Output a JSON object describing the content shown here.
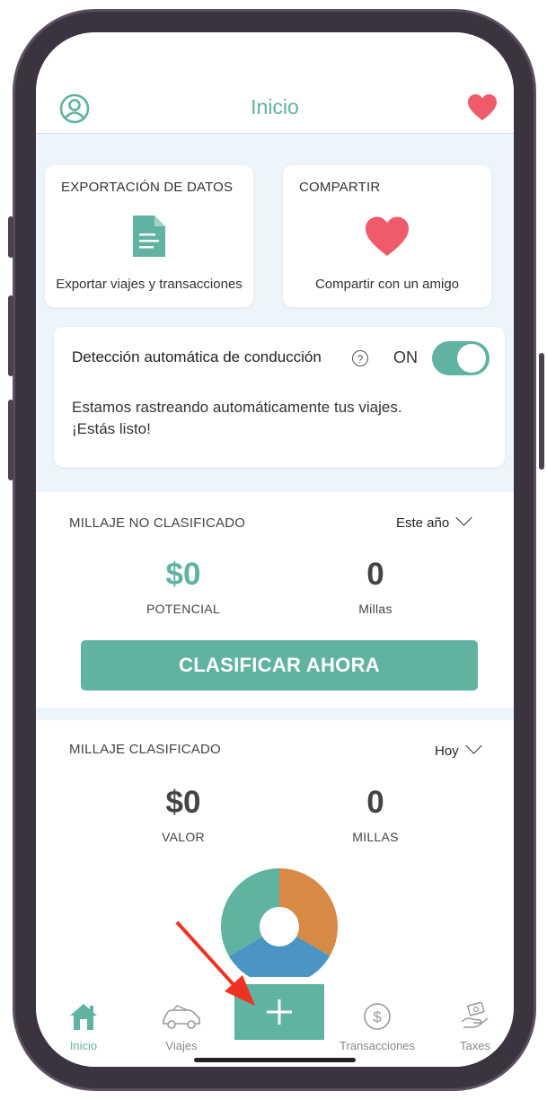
{
  "header": {
    "title": "Inicio"
  },
  "export_card": {
    "heading": "EXPORTACIÓN DE DATOS",
    "subtitle": "Exportar viajes y transacciones"
  },
  "share_card": {
    "heading": "COMPARTIR",
    "subtitle": "Compartir con un amigo"
  },
  "auto_detect": {
    "title": "Detección automática de conducción",
    "help": "?",
    "state_label": "ON",
    "enabled": true,
    "message_line1": "Estamos rastreando automáticamente tus viajes.",
    "message_line2": "¡Estás listo!"
  },
  "unclassified": {
    "label": "MILLAJE NO CLASIFICADO",
    "period": "Este año",
    "potential_value": "$0",
    "potential_caption": "POTENCIAL",
    "miles_value": "0",
    "miles_caption": "Millas",
    "button": "CLASIFICAR AHORA"
  },
  "classified": {
    "label": "MILLAJE CLASIFICADO",
    "period": "Hoy",
    "value": "$0",
    "value_caption": "VALOR",
    "miles": "0",
    "miles_caption": "MILLAS"
  },
  "chart_data": {
    "type": "pie",
    "variant": "donut",
    "slices": [
      {
        "fraction": 0.333,
        "color": "#d68a45"
      },
      {
        "fraction": 0.333,
        "color": "#4a95c3"
      },
      {
        "fraction": 0.334,
        "color": "#5fb3a0"
      }
    ]
  },
  "tabs": [
    {
      "label": "Inicio",
      "icon": "home-icon",
      "active": true
    },
    {
      "label": "Viajes",
      "icon": "car-icon",
      "active": false
    },
    {
      "label": "Transacciones",
      "icon": "dollar-icon",
      "active": false
    },
    {
      "label": "Taxes",
      "icon": "hand-money-icon",
      "active": false
    }
  ],
  "colors": {
    "accent": "#5fb3a0",
    "heart": "#ef5b6a",
    "annotation_arrow": "#ee3322"
  }
}
